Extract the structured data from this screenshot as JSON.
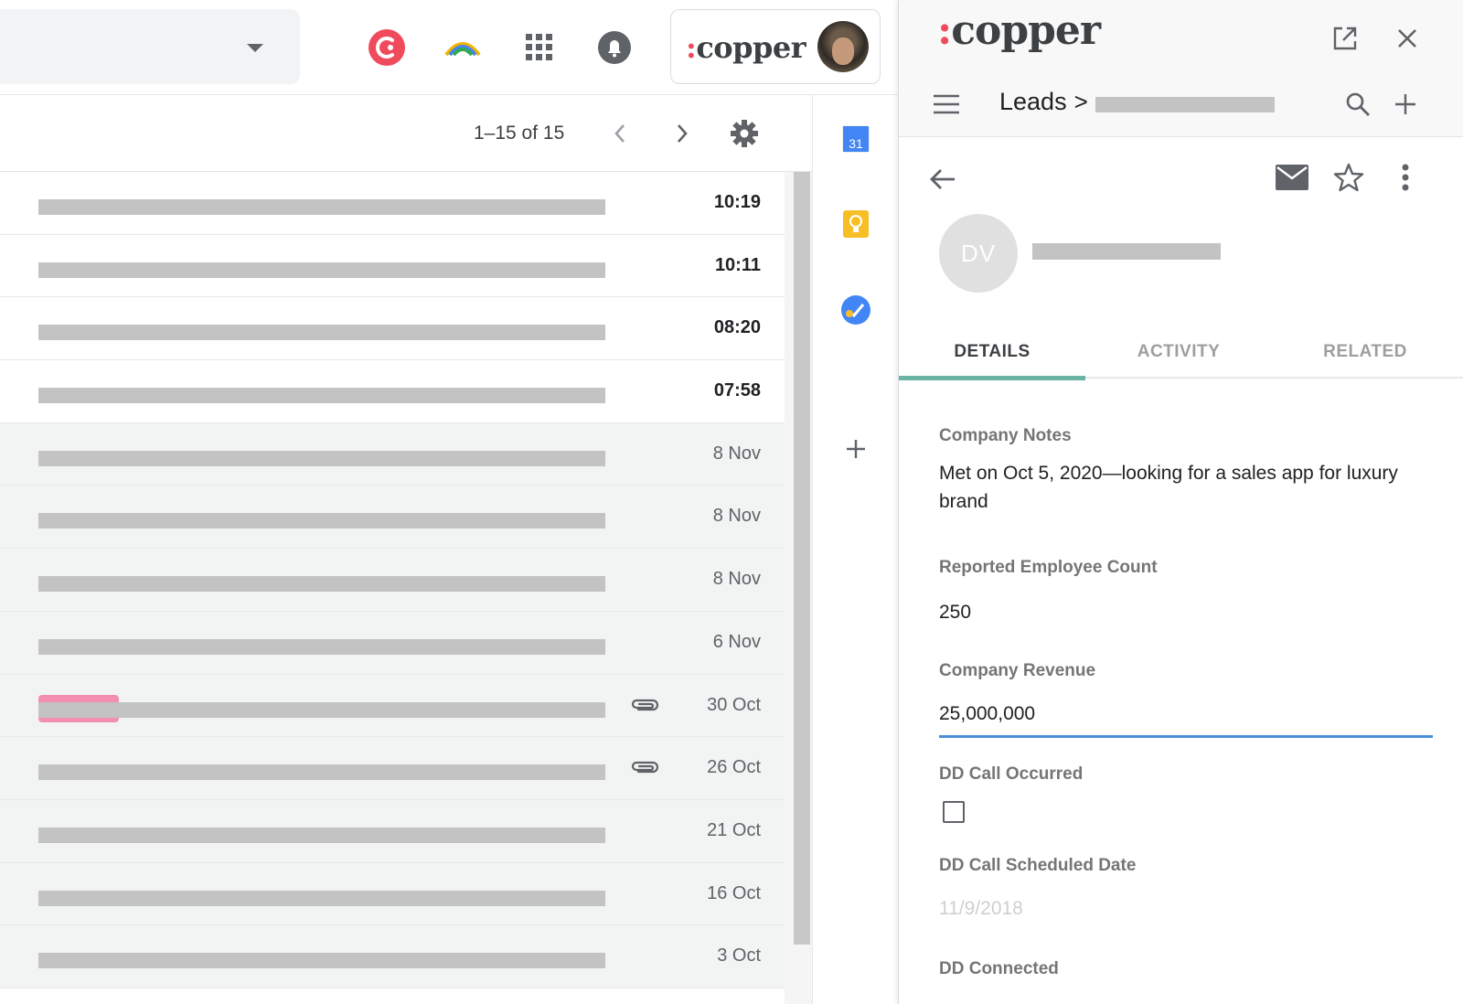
{
  "gmail": {
    "pagination": {
      "range": "1–15 of 15"
    },
    "rows": [
      {
        "date": "10:19",
        "unread": true,
        "attachment": false,
        "label": false
      },
      {
        "date": "10:11",
        "unread": true,
        "attachment": false,
        "label": false
      },
      {
        "date": "08:20",
        "unread": true,
        "attachment": false,
        "label": false
      },
      {
        "date": "07:58",
        "unread": true,
        "attachment": false,
        "label": false
      },
      {
        "date": "8 Nov",
        "unread": false,
        "attachment": false,
        "label": false
      },
      {
        "date": "8 Nov",
        "unread": false,
        "attachment": false,
        "label": false
      },
      {
        "date": "8 Nov",
        "unread": false,
        "attachment": false,
        "label": false
      },
      {
        "date": "6 Nov",
        "unread": false,
        "attachment": false,
        "label": false
      },
      {
        "date": "30 Oct",
        "unread": false,
        "attachment": true,
        "label": true
      },
      {
        "date": "26 Oct",
        "unread": false,
        "attachment": true,
        "label": false
      },
      {
        "date": "21 Oct",
        "unread": false,
        "attachment": false,
        "label": false
      },
      {
        "date": "16 Oct",
        "unread": false,
        "attachment": false,
        "label": false
      },
      {
        "date": "3 Oct",
        "unread": false,
        "attachment": false,
        "label": false
      }
    ],
    "side_apps": {
      "calendar_day": "31"
    },
    "copper_badge": {
      "logo": "copper"
    }
  },
  "copper": {
    "logo": "copper",
    "breadcrumb": {
      "section": "Leads",
      "separator": ">"
    },
    "record": {
      "initials": "DV"
    },
    "tabs": [
      "DETAILS",
      "ACTIVITY",
      "RELATED"
    ],
    "active_tab": "DETAILS",
    "fields": {
      "company_notes": {
        "label": "Company Notes",
        "value": "Met on Oct 5, 2020—looking for a sales app for luxury brand"
      },
      "employee_count": {
        "label": "Reported Employee Count",
        "value": "250"
      },
      "company_revenue": {
        "label": "Company Revenue",
        "value": "25,000,000"
      },
      "dd_call_occurred": {
        "label": "DD Call Occurred",
        "checked": false
      },
      "dd_call_scheduled": {
        "label": "DD Call Scheduled Date",
        "placeholder": "11/9/2018"
      },
      "dd_connected": {
        "label": "DD Connected"
      }
    }
  },
  "colors": {
    "accent_tab": "#6ab3a5",
    "copper_red": "#f04a5d",
    "input_focus": "#4a90d9"
  }
}
